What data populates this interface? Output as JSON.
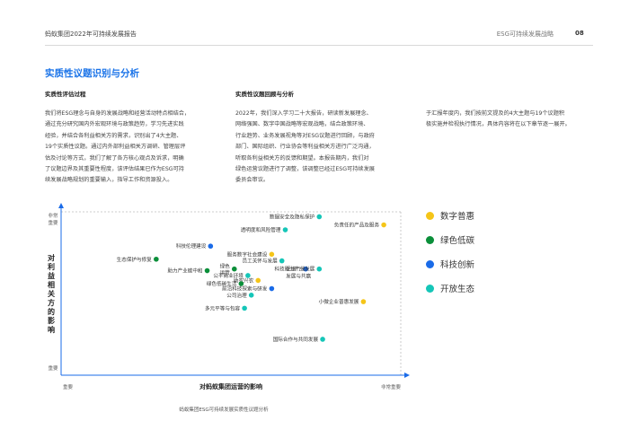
{
  "header": {
    "left": "蚂蚁集团2022年可持续发展报告",
    "right": "ESG可持续发展战略",
    "page": "08"
  },
  "section_title": "实质性议题识别与分析",
  "columns": [
    {
      "heading": "实质性评估过程",
      "lines": [
        "我们将ESG理念与自身的发展战略和经营活动特点相结合，",
        "通过充分研究国内外宏观环境与政策趋势，学习先进实践",
        "经验，并结合各利益相关方的需求，识别出了4大主题、",
        "19个实质性议题。通过内外部利益相关方调研、管理层评",
        "估及讨论等方式，我们了解了各方核心观点及诉求，明确",
        "了议题边界及其重要性程度，该评估结果已作为ESG可持",
        "续发展战略规划的重要输入，指导工作和资源投入。"
      ]
    },
    {
      "heading": "实质性议题回顾与分析",
      "lines": [
        "2022年，我们深入学习二十大报告，研读新发展理念、",
        "网络强国、数字中国战略等宏观战略，结合政策环境、",
        "行业趋势、业务发展视角等对ESG议题进行回顾，与政府",
        "部门、国际组织、行业协会等利益相关方进行广泛沟通，",
        "听取各利益相关方的反馈和期望。本报告期内，我们对",
        "绿色运营议题进行了调整，该调整已经过ESG可持续发展",
        "委员会审议。"
      ]
    },
    {
      "heading": "",
      "lines": [
        "于汇报年度内，我们按前文提及的4大主题与19个议题积",
        "极实施并检视执行情况，具体内容将在以下章节逐一展开。"
      ]
    }
  ],
  "chart_data": {
    "type": "scatter",
    "xlabel": "对蚂蚁集团运营的影响",
    "ylabel": "对利益相关方的影响",
    "x_tick_labels": [
      "重要",
      "非常重要"
    ],
    "y_tick_labels": [
      "重要",
      "非常重要"
    ],
    "xlim": [
      0,
      100
    ],
    "ylim": [
      0,
      100
    ],
    "grid": false,
    "legend_position": "right",
    "caption": "蚂蚁集团ESG可持续发展实质性议题分析",
    "series": [
      {
        "name": "数字普惠",
        "color": "#f5c518",
        "points": [
          {
            "label": "负责任的产品及服务",
            "x": 95,
            "y": 92
          },
          {
            "label": "服务数字社会建设",
            "x": 62,
            "y": 74
          },
          {
            "label": "助农兴农",
            "x": 58,
            "y": 58
          },
          {
            "label": "小微企业普惠发展",
            "x": 89,
            "y": 45
          }
        ]
      },
      {
        "name": "绿色低碳",
        "color": "#0b8f3a",
        "points": [
          {
            "label": "生态保护与修复",
            "x": 28,
            "y": 71
          },
          {
            "label": "助力产业碳中和",
            "x": 43,
            "y": 64
          },
          {
            "label": "绿色运营",
            "x": 51,
            "y": 65
          },
          {
            "label": "绿色低碳生活",
            "x": 53,
            "y": 56
          }
        ]
      },
      {
        "name": "科技创新",
        "color": "#1a6be8",
        "points": [
          {
            "label": "科技伦理建设",
            "x": 44,
            "y": 79
          },
          {
            "label": "前沿科技探索与研发",
            "x": 62,
            "y": 53
          },
          {
            "label": "促进行业发展与共赢",
            "x": 72,
            "y": 65
          }
        ]
      },
      {
        "name": "开放生态",
        "color": "#15c6b8",
        "points": [
          {
            "label": "数据安全及隐私保护",
            "x": 76,
            "y": 97
          },
          {
            "label": "透明度和风险管理",
            "x": 66,
            "y": 89
          },
          {
            "label": "员工关怀与发展",
            "x": 65,
            "y": 70
          },
          {
            "label": "科技助力产业发展",
            "x": 76,
            "y": 65
          },
          {
            "label": "公平商业环境",
            "x": 55,
            "y": 61
          },
          {
            "label": "公司治理",
            "x": 56,
            "y": 49
          },
          {
            "label": "多元平等与包容",
            "x": 54,
            "y": 41
          },
          {
            "label": "国际合作与共同发展",
            "x": 77,
            "y": 22
          }
        ]
      }
    ]
  }
}
